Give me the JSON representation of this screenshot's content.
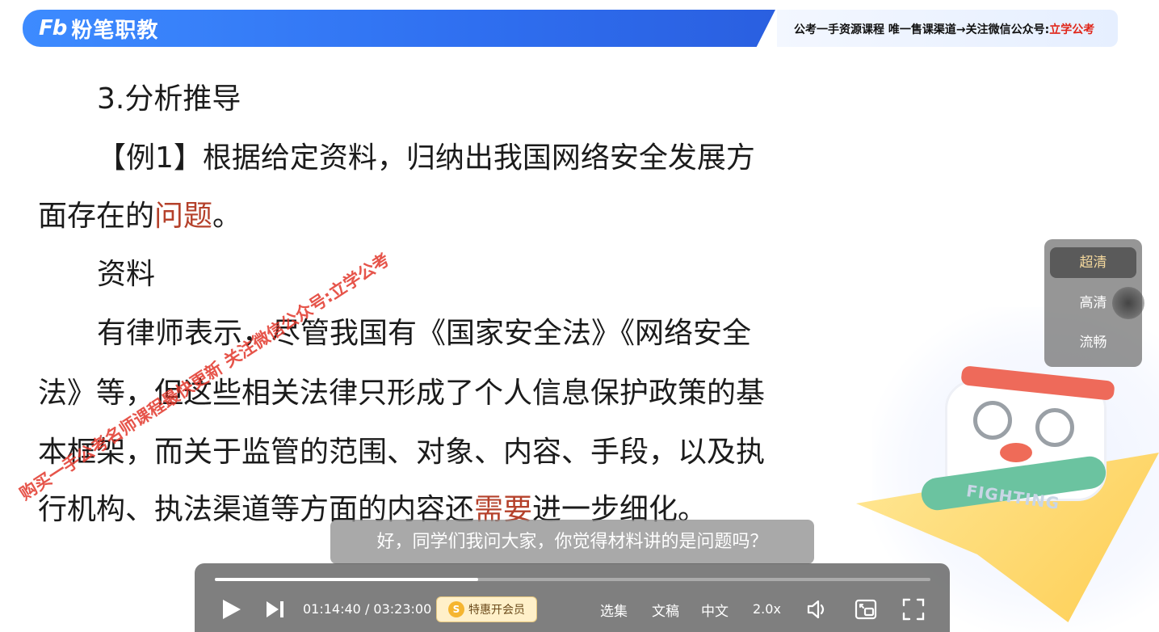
{
  "banner": {
    "logo_mark": "Fb",
    "logo_text": "粉笔职教",
    "promo_text": "公考一手资源课程 唯一售课渠道→关注微信公众号:",
    "promo_highlight": "立学公考",
    "colors": {
      "brand_blue": "#2f6ff0",
      "promo_red": "#e0261a"
    }
  },
  "slide": {
    "heading": "3.分析推导",
    "example_line1": "【例1】根据给定资料，归纳出我国网络安全发展方",
    "example_line2_pre": "面存在的",
    "example_line2_hl": "问题",
    "example_line2_post": "。",
    "material_label": "资料",
    "para_line1": "有律师表示，尽管我国有《国家安全法》《网络安全",
    "para_line2": "法》等，但这些相关法律只形成了个人信息保护政策的基",
    "para_line3": "本框架，而关于监管的范围、对象、内容、手段，以及执",
    "para_line4_pre": "行机构、执法渠道等方面的内容还",
    "para_line4_hl": "需要",
    "para_line4_post": "进一步细化。",
    "highlight_color": "#b5412b"
  },
  "watermark": {
    "text": "购买一手公考名师课程最快更新 关注微信公众号:立学公考"
  },
  "mascot": {
    "text": "FIGHTING"
  },
  "quality_menu": {
    "items": [
      "超清",
      "高清",
      "流畅"
    ],
    "selected": "超清"
  },
  "subtitle": {
    "text": "好，同学们我问大家，你觉得材料讲的是问题吗？"
  },
  "player": {
    "current_time": "01:14:40",
    "total_time": "03:23:00",
    "time_display": "01:14:40 / 03:23:00",
    "progress_fraction": 0.368,
    "vip_label": "特惠开会员",
    "vip_coin": "S",
    "episodes_label": "选集",
    "doc_label": "文稿",
    "language_label": "中文",
    "speed_label": "2.0x",
    "icons": [
      "play-icon",
      "next-icon",
      "volume-icon",
      "pip-icon",
      "fullscreen-icon"
    ]
  }
}
